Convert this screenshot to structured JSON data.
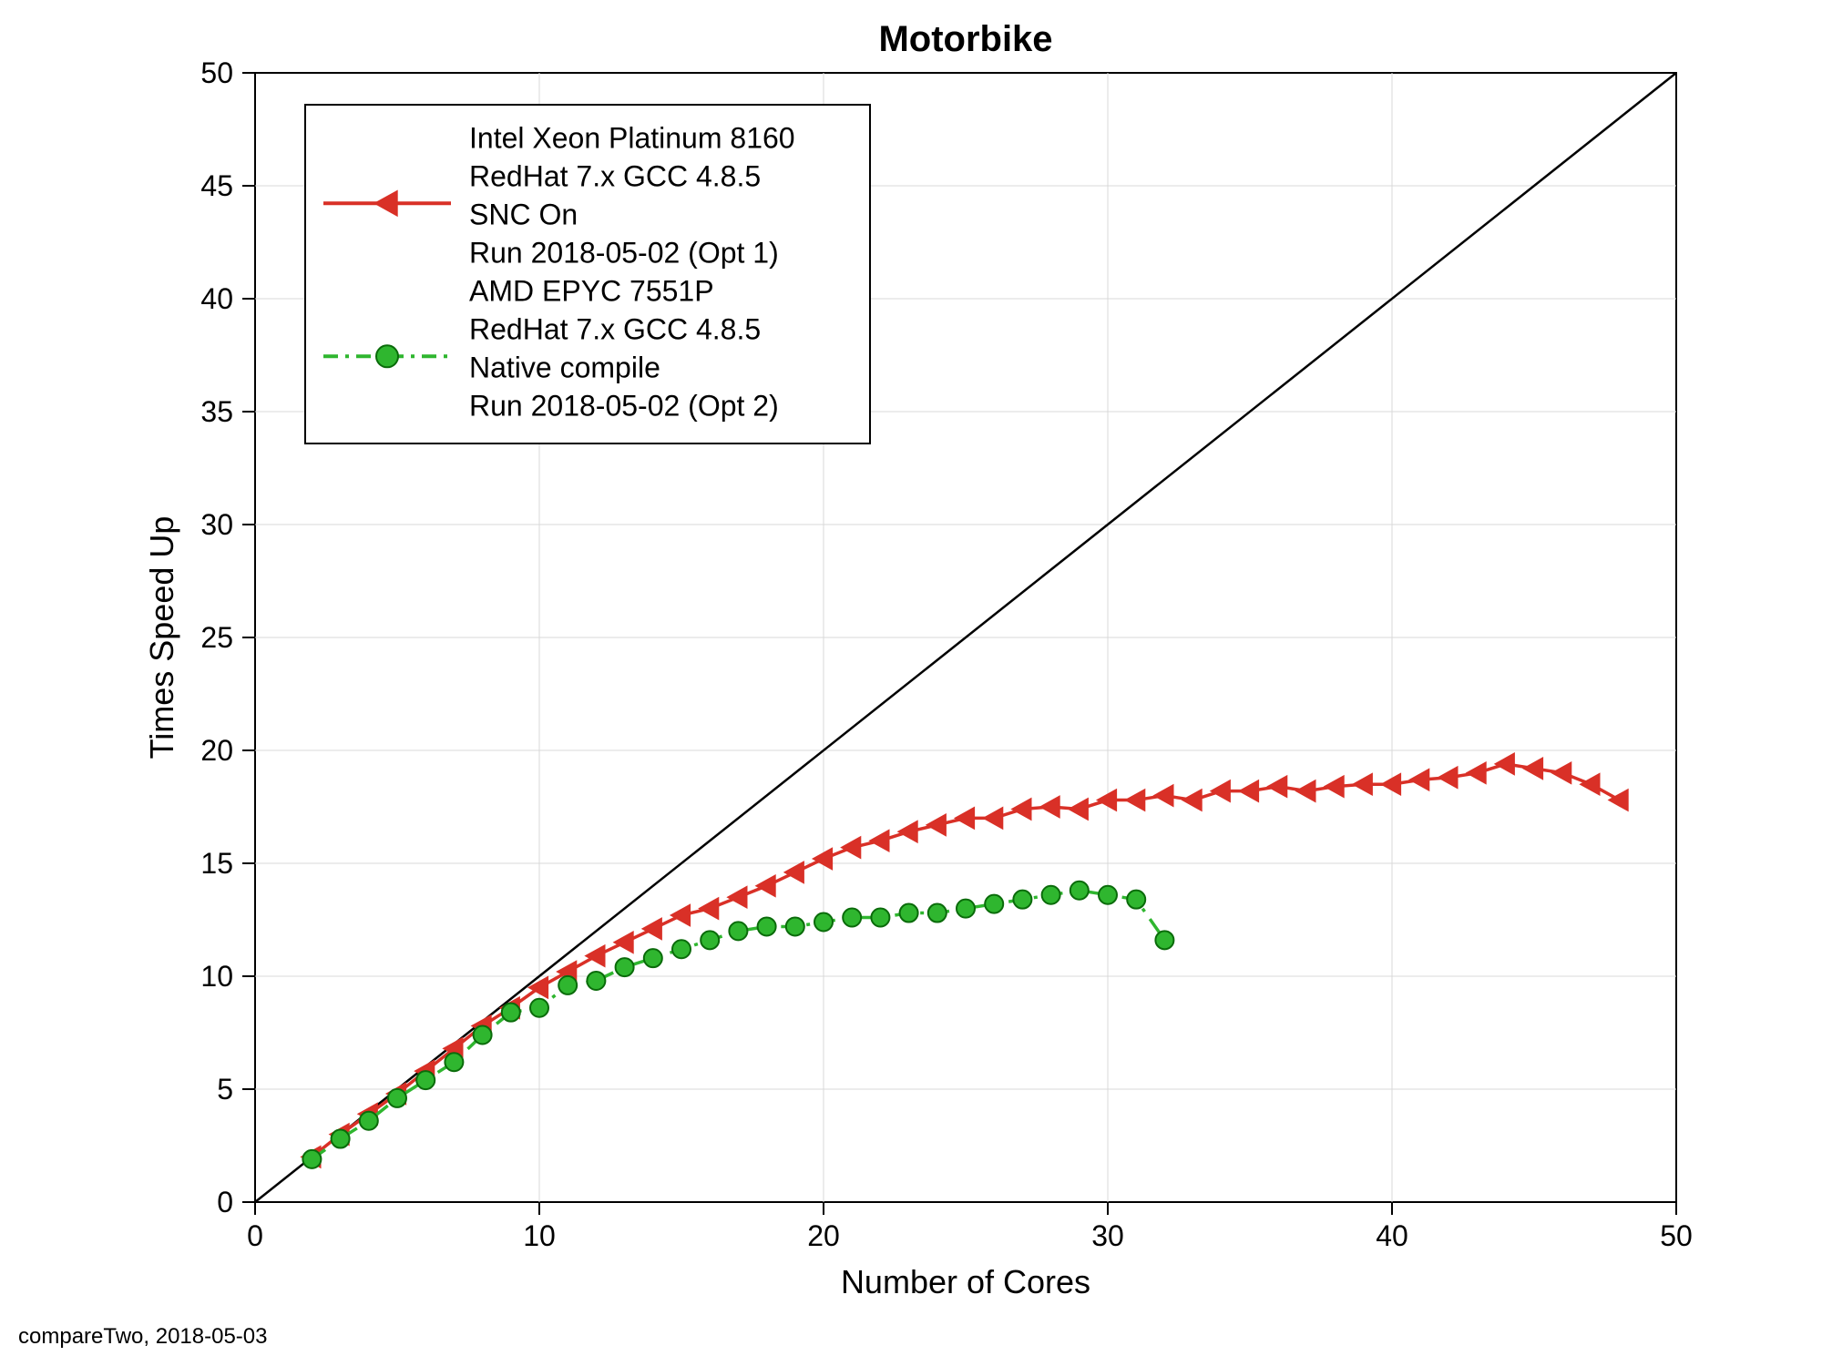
{
  "footer": "compareTwo, 2018-05-03",
  "chart_data": {
    "type": "line",
    "title": "Motorbike",
    "xlabel": "Number of Cores",
    "ylabel": "Times Speed Up",
    "xlim": [
      0,
      50
    ],
    "ylim": [
      0,
      50
    ],
    "xticks": [
      0,
      10,
      20,
      30,
      40,
      50
    ],
    "yticks": [
      0,
      5,
      10,
      15,
      20,
      25,
      30,
      35,
      40,
      45,
      50
    ],
    "grid": true,
    "reference_line": {
      "from": [
        0,
        0
      ],
      "to": [
        50,
        50
      ]
    },
    "legend": {
      "position": "upper-left-inside",
      "entries": [
        {
          "series": "intel",
          "lines": [
            "Intel Xeon Platinum 8160",
            "RedHat 7.x GCC 4.8.5",
            "SNC On",
            "Run 2018-05-02 (Opt 1)"
          ]
        },
        {
          "series": "amd",
          "lines": [
            "AMD EPYC 7551P",
            "RedHat 7.x GCC 4.8.5",
            "Native compile",
            "Run 2018-05-02 (Opt 2)"
          ]
        }
      ]
    },
    "series": [
      {
        "id": "intel",
        "name": "Intel Xeon Platinum 8160 / RedHat 7.x GCC 4.8.5 / SNC On / Run 2018-05-02 (Opt 1)",
        "color": "#d93027",
        "marker": "triangle-left",
        "dash": "solid",
        "x": [
          2,
          3,
          4,
          5,
          6,
          7,
          8,
          9,
          10,
          11,
          12,
          13,
          14,
          15,
          16,
          17,
          18,
          19,
          20,
          21,
          22,
          23,
          24,
          25,
          26,
          27,
          28,
          29,
          30,
          31,
          32,
          33,
          34,
          35,
          36,
          37,
          38,
          39,
          40,
          41,
          42,
          43,
          44,
          45,
          46,
          47,
          48
        ],
        "y": [
          2.0,
          3.0,
          3.9,
          4.8,
          5.8,
          6.8,
          7.8,
          8.6,
          9.5,
          10.2,
          10.9,
          11.5,
          12.1,
          12.7,
          13.0,
          13.5,
          14.0,
          14.6,
          15.2,
          15.7,
          16.0,
          16.4,
          16.7,
          17.0,
          17.0,
          17.4,
          17.5,
          17.4,
          17.8,
          17.8,
          18.0,
          17.8,
          18.2,
          18.2,
          18.4,
          18.2,
          18.4,
          18.5,
          18.5,
          18.7,
          18.8,
          19.0,
          19.4,
          19.2,
          19.0,
          18.5,
          17.8
        ]
      },
      {
        "id": "amd",
        "name": "AMD EPYC 7551P / RedHat 7.x GCC 4.8.5 / Native compile / Run 2018-05-02 (Opt 2)",
        "color": "#2fb62f",
        "marker": "circle",
        "dash": "dashdot",
        "x": [
          2,
          3,
          4,
          5,
          6,
          7,
          8,
          9,
          10,
          11,
          12,
          13,
          14,
          15,
          16,
          17,
          18,
          19,
          20,
          21,
          22,
          23,
          24,
          25,
          26,
          27,
          28,
          29,
          30,
          31,
          32
        ],
        "y": [
          1.9,
          2.8,
          3.6,
          4.6,
          5.4,
          6.2,
          7.4,
          8.4,
          8.6,
          9.6,
          9.8,
          10.4,
          10.8,
          11.2,
          11.6,
          12.0,
          12.2,
          12.2,
          12.4,
          12.6,
          12.6,
          12.8,
          12.8,
          13.0,
          13.2,
          13.4,
          13.6,
          13.8,
          13.6,
          13.4,
          11.6
        ]
      }
    ]
  }
}
